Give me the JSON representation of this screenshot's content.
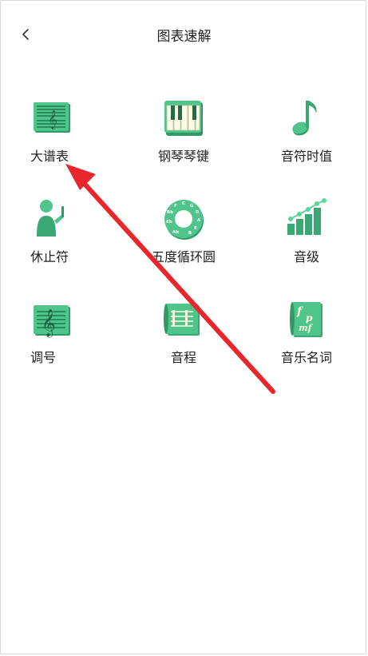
{
  "header": {
    "title": "图表速解",
    "back_icon": "chevron-left-icon"
  },
  "grid": {
    "items": [
      {
        "label": "大谱表",
        "icon": "grand-staff-icon"
      },
      {
        "label": "钢琴琴键",
        "icon": "piano-keys-icon"
      },
      {
        "label": "音符时值",
        "icon": "music-note-icon"
      },
      {
        "label": "休止符",
        "icon": "person-rest-icon"
      },
      {
        "label": "五度循环圆",
        "icon": "circle-of-fifths-icon"
      },
      {
        "label": "音级",
        "icon": "bar-steps-icon"
      },
      {
        "label": "调号",
        "icon": "treble-clef-staff-icon"
      },
      {
        "label": "音程",
        "icon": "scroll-staff-icon"
      },
      {
        "label": "音乐名词",
        "icon": "dynamics-scroll-icon"
      }
    ],
    "circle_letters": [
      "C",
      "G",
      "D",
      "A",
      "E",
      "B",
      "F",
      "Bb",
      "Eb",
      "Ab"
    ],
    "dynamics": [
      "f",
      "p",
      "mf"
    ]
  },
  "colors": {
    "accent": "#3aa874",
    "accent_dark": "#2a8a5c",
    "arrow": "#e8262b"
  }
}
